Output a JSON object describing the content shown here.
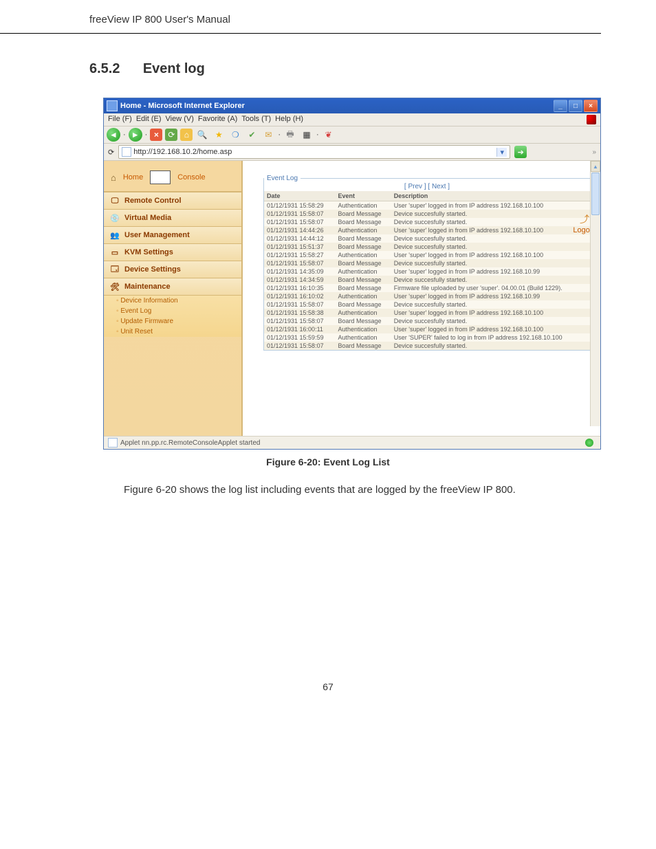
{
  "doc": {
    "header": "freeView IP 800 User's Manual",
    "section_num": "6.5.2",
    "section_title": "Event log",
    "fig_caption": "Figure 6-20: Event Log List",
    "fig_desc": "Figure 6-20 shows the log list including events that are logged by the freeView IP 800.",
    "page_num": "67"
  },
  "window": {
    "title": "Home - Microsoft Internet Explorer",
    "menu": {
      "file": "File (F)",
      "edit": "Edit (E)",
      "view": "View (V)",
      "fav": "Favorite (A)",
      "tools": "Tools (T)",
      "help": "Help (H)"
    },
    "address": "http://192.168.10.2/home.asp",
    "status": "Applet nn.pp.rc.RemoteConsoleApplet started",
    "chev": "»"
  },
  "header_area": {
    "home": "Home",
    "console": "Console",
    "logout": "Logout"
  },
  "nav": {
    "remote": "Remote Control",
    "virtual": "Virtual Media",
    "user": "User Management",
    "kvm": "KVM Settings",
    "device": "Device Settings",
    "maint": "Maintenance",
    "sub_devinfo": "Device Information",
    "sub_evtlog": "Event Log",
    "sub_updatefw": "Update Firmware",
    "sub_unitreset": "Unit Reset"
  },
  "panel": {
    "legend": "Event Log",
    "nav_prev": "[ Prev ]",
    "nav_next": "[ Next ]",
    "col_date": "Date",
    "col_event": "Event",
    "col_desc": "Description",
    "rows": [
      {
        "date": "01/12/1931 15:58:29",
        "event": "Authentication",
        "desc": "User 'super' logged in from IP address 192.168.10.100"
      },
      {
        "date": "01/12/1931 15:58:07",
        "event": "Board Message",
        "desc": "Device succesfully started."
      },
      {
        "date": "01/12/1931 15:58:07",
        "event": "Board Message",
        "desc": "Device succesfully started."
      },
      {
        "date": "01/12/1931 14:44:26",
        "event": "Authentication",
        "desc": "User 'super' logged in from IP address 192.168.10.100"
      },
      {
        "date": "01/12/1931 14:44:12",
        "event": "Board Message",
        "desc": "Device succesfully started."
      },
      {
        "date": "01/12/1931 15:51:37",
        "event": "Board Message",
        "desc": "Device succesfully started."
      },
      {
        "date": "01/12/1931 15:58:27",
        "event": "Authentication",
        "desc": "User 'super' logged in from IP address 192.168.10.100"
      },
      {
        "date": "01/12/1931 15:58:07",
        "event": "Board Message",
        "desc": "Device succesfully started."
      },
      {
        "date": "01/12/1931 14:35:09",
        "event": "Authentication",
        "desc": "User 'super' logged in from IP address 192.168.10.99"
      },
      {
        "date": "01/12/1931 14:34:59",
        "event": "Board Message",
        "desc": "Device succesfully started."
      },
      {
        "date": "01/12/1931 16:10:35",
        "event": "Board Message",
        "desc": "Firmware file uploaded by user 'super'. 04.00.01 (Build 1229)."
      },
      {
        "date": "01/12/1931 16:10:02",
        "event": "Authentication",
        "desc": "User 'super' logged in from IP address 192.168.10.99"
      },
      {
        "date": "01/12/1931 15:58:07",
        "event": "Board Message",
        "desc": "Device succesfully started."
      },
      {
        "date": "01/12/1931 15:58:38",
        "event": "Authentication",
        "desc": "User 'super' logged in from IP address 192.168.10.100"
      },
      {
        "date": "01/12/1931 15:58:07",
        "event": "Board Message",
        "desc": "Device succesfully started."
      },
      {
        "date": "01/12/1931 16:00:11",
        "event": "Authentication",
        "desc": "User 'super' logged in from IP address 192.168.10.100"
      },
      {
        "date": "01/12/1931 15:59:59",
        "event": "Authentication",
        "desc": "User 'SUPER' failed to log in from IP address 192.168.10.100"
      },
      {
        "date": "01/12/1931 15:58:07",
        "event": "Board Message",
        "desc": "Device succesfully started."
      }
    ]
  }
}
